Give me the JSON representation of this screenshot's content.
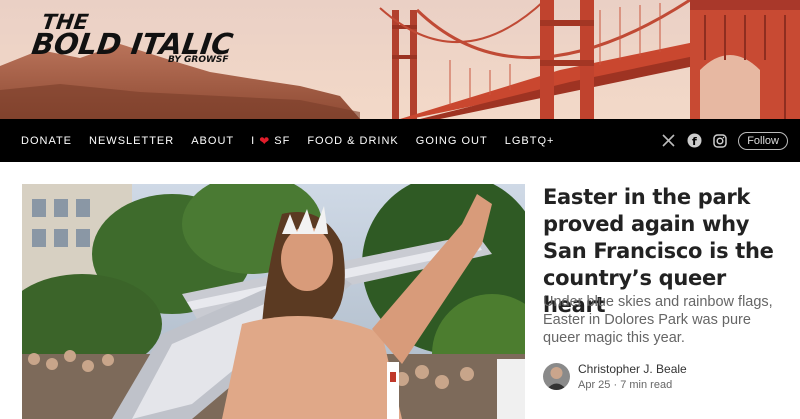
{
  "logo": {
    "line1": "THE",
    "line2": "BOLD ITALIC",
    "line3": "BY GROWSF"
  },
  "nav": {
    "items": [
      "DONATE",
      "NEWSLETTER",
      "ABOUT",
      "I",
      "SF",
      "FOOD & DRINK",
      "GOING OUT",
      "LGBTQ+"
    ],
    "follow_label": "Follow",
    "icons": [
      "x-icon",
      "facebook-icon",
      "instagram-icon"
    ]
  },
  "article": {
    "headline": "Easter in the park proved again why San Francisco is the country’s queer heart",
    "dek": "Under blue skies and rainbow flags, Easter in Dolores Park was pure queer magic this year.",
    "author": "Christopher J. Beale",
    "date": "Apr 25",
    "separator": "·",
    "read_time": "7 min read"
  },
  "colors": {
    "nav_bg": "#000000",
    "heart": "#e21d2b",
    "bridge": "#c0392b"
  }
}
